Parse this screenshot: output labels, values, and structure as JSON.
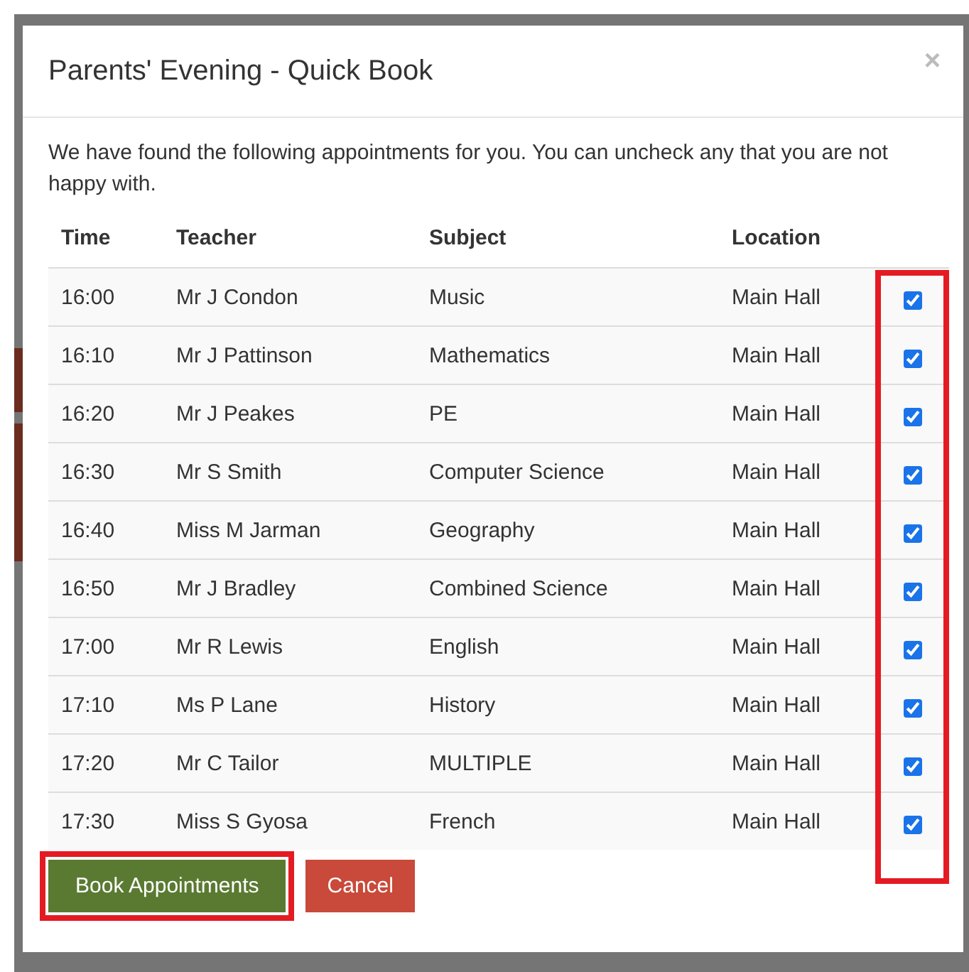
{
  "dialog": {
    "title": "Parents' Evening - Quick Book",
    "close": "×"
  },
  "intro": "We have found the following appointments for you. You can uncheck any that you are not happy with.",
  "table": {
    "columns": [
      "Time",
      "Teacher",
      "Subject",
      "Location"
    ],
    "checkboxes_highlighted": true,
    "rows": [
      {
        "time": "16:00",
        "teacher": "Mr J Condon",
        "subject": "Music",
        "location": "Main Hall",
        "checked": true
      },
      {
        "time": "16:10",
        "teacher": "Mr J Pattinson",
        "subject": "Mathematics",
        "location": "Main Hall",
        "checked": true
      },
      {
        "time": "16:20",
        "teacher": "Mr J Peakes",
        "subject": "PE",
        "location": "Main Hall",
        "checked": true
      },
      {
        "time": "16:30",
        "teacher": "Mr S Smith",
        "subject": "Computer Science",
        "location": "Main Hall",
        "checked": true
      },
      {
        "time": "16:40",
        "teacher": "Miss M Jarman",
        "subject": "Geography",
        "location": "Main Hall",
        "checked": true
      },
      {
        "time": "16:50",
        "teacher": "Mr J Bradley",
        "subject": "Combined Science",
        "location": "Main Hall",
        "checked": true
      },
      {
        "time": "17:00",
        "teacher": "Mr R Lewis",
        "subject": "English",
        "location": "Main Hall",
        "checked": true
      },
      {
        "time": "17:10",
        "teacher": "Ms P Lane",
        "subject": "History",
        "location": "Main Hall",
        "checked": true
      },
      {
        "time": "17:20",
        "teacher": "Mr C Tailor",
        "subject": "MULTIPLE",
        "location": "Main Hall",
        "checked": true
      },
      {
        "time": "17:30",
        "teacher": "Miss S Gyosa",
        "subject": "French",
        "location": "Main Hall",
        "checked": true
      }
    ]
  },
  "buttons": [
    {
      "label": "Book Appointments",
      "kind": "primary",
      "highlighted": true
    },
    {
      "label": "Cancel",
      "kind": "danger",
      "highlighted": false
    }
  ]
}
